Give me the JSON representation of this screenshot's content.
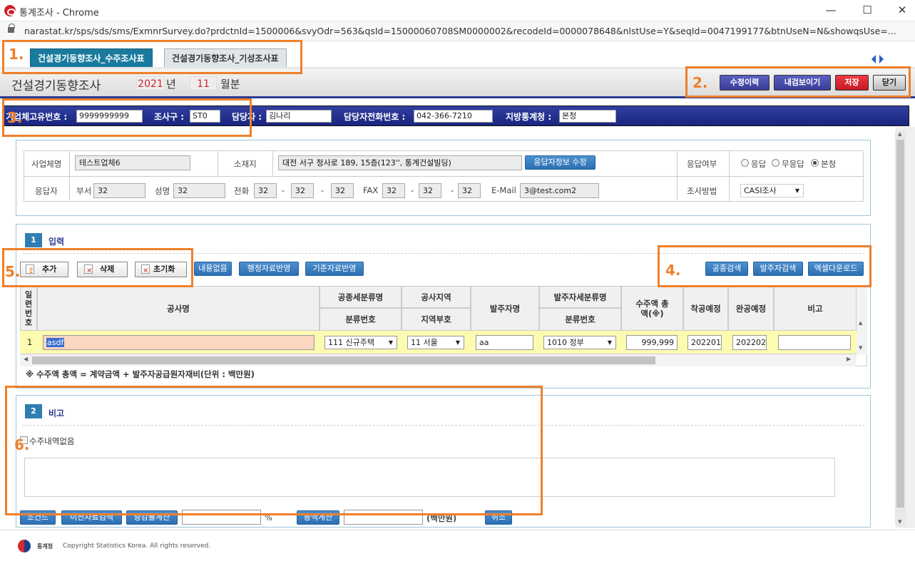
{
  "window": {
    "title": "통계조사 - Chrome",
    "url": "narastat.kr/sps/sds/sms/ExmnrSurvey.do?prdctnId=1500006&svyOdr=563&qsId=15000060708SM0000002&recodeId=0000078648&nlstUse=Y&seqId=0047199177&btnUseN=N&showqsUse=..."
  },
  "tabs": [
    {
      "label": "건설경기동향조사_수주조사표"
    },
    {
      "label": "건설경기동향조사_기성조사표"
    }
  ],
  "header": {
    "title": "건설경기동향조사",
    "year": "2021",
    "year_unit": "년",
    "month": "11",
    "month_unit": "월분"
  },
  "toolbar": {
    "history": "수정이력",
    "preview": "내검보이기",
    "save": "저장",
    "close": "닫기"
  },
  "info": {
    "id_label": "기업체고유번호 :",
    "id_value": "9999999999",
    "surveyor_label": "조사구 :",
    "surveyor_value": "ST0",
    "manager_label": "담당자 :",
    "manager_value": "김나리",
    "phone_label": "담당자전화번호 :",
    "phone_value": "042-366-7210",
    "region_label": "지방통계청 :",
    "region_value": "본청"
  },
  "company": {
    "name_label": "사업체명",
    "name_value": "테스트업체6",
    "addr_label": "소재지",
    "addr_value": "대전 서구 청사로 189, 15층(123'', 통계건설빌딩)",
    "edit_btn": "응답자정보 수정",
    "resp_label": "응답여부",
    "opt1": "응답",
    "opt2": "무응답",
    "opt3": "본청",
    "respondent_label": "응답자",
    "dept_label": "부서",
    "dept_value": "32",
    "nm_label": "성명",
    "nm_value": "32",
    "tel_label": "전화",
    "tel1": "32",
    "tel2": "32",
    "tel3": "32",
    "fax_label": "FAX",
    "fax1": "32",
    "fax2": "32",
    "fax3": "32",
    "email_label": "E-Mail",
    "email_value": "3@test.com2",
    "dash": "-",
    "method_label": "조사방법",
    "method_value": "CASI조사"
  },
  "sec1": {
    "num": "1",
    "title": "입력",
    "add": "추가",
    "del": "삭제",
    "reset": "초기화",
    "none": "내용없음",
    "admin": "행정자료반영",
    "base": "기준자료반영",
    "search1": "공종검색",
    "search2": "발주자검색",
    "excel": "엑셀다운로드"
  },
  "table": {
    "h_seq": "일련번호",
    "h_name": "공사명",
    "h_type": "공종세분류명",
    "h_type2": "분류번호",
    "h_area": "공사지역",
    "h_area2": "지역부호",
    "h_client": "발주자명",
    "h_ctype": "발주자세분류명",
    "h_ctype2": "분류번호",
    "h_amt": "수주액 총액(※)",
    "h_start": "착공예정",
    "h_end": "완공예정",
    "h_note": "비고",
    "rows": [
      {
        "seq": "1",
        "name": "asdf",
        "type": "111 신규주택",
        "area": "11 서울",
        "client": "aa",
        "ctype": "1010 정부",
        "amt": "999,999",
        "start": "202201",
        "end": "202202",
        "note": ""
      }
    ],
    "footnote": "※ 수주액 총액 = 계약금액 + 발주자공급원자재비(단위 : 백만원)"
  },
  "sec2": {
    "num": "2",
    "title": "비고",
    "chk": "수주내역없음"
  },
  "bottom": {
    "b1": "조건드",
    "b2": "이전자료검색",
    "b3": "증감률계산",
    "pct": "%",
    "b4": "총액계산",
    "unit": "(백만원)",
    "b5": "취소"
  },
  "footer": {
    "logo": "통계청",
    "copy": "Copyright Statistics Korea. All rights reserved."
  },
  "annotations": {
    "n1": "1.",
    "n2": "2.",
    "n3": "3.",
    "n4": "4.",
    "n5": "5.",
    "n6": "6."
  }
}
